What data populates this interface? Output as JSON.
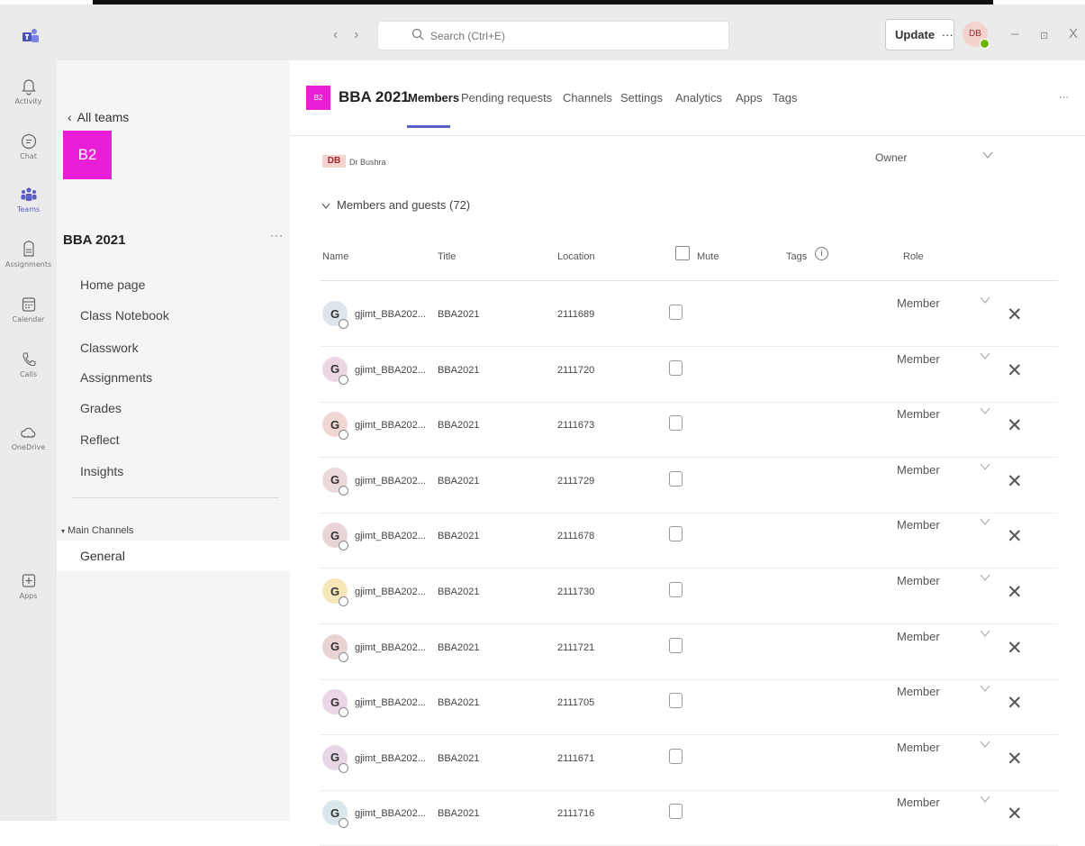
{
  "titlebar": {
    "search_placeholder": "Search (Ctrl+E)",
    "update_label": "Update",
    "update_more": "···",
    "user_initials": "DB",
    "window_controls": [
      "–",
      "⊡",
      "X"
    ]
  },
  "rail": [
    {
      "label": "Activity",
      "icon": "bell-icon"
    },
    {
      "label": "Chat",
      "icon": "chat-icon"
    },
    {
      "label": "Teams",
      "icon": "teams-icon",
      "active": true
    },
    {
      "label": "Assignments",
      "icon": "assignments-icon"
    },
    {
      "label": "Calendar",
      "icon": "calendar-icon"
    },
    {
      "label": "Calls",
      "icon": "phone-icon"
    },
    {
      "label": "OneDrive",
      "icon": "cloud-icon"
    },
    {
      "label": "Apps",
      "icon": "plus-box-icon"
    }
  ],
  "rail_more": "···",
  "sidebar": {
    "back_label": "All teams",
    "team_initials": "B2",
    "team_name": "BBA 2021",
    "team_more": "···",
    "links": [
      "Home page",
      "Class Notebook",
      "Classwork",
      "Assignments",
      "Grades",
      "Reflect",
      "Insights"
    ],
    "channels_heading": "Main Channels",
    "channel": "General"
  },
  "header": {
    "team_initials": "B2",
    "title": "BBA 2021",
    "tabs": [
      "Members",
      "Pending requests",
      "Channels",
      "Settings",
      "Analytics",
      "Apps",
      "Tags"
    ],
    "more": "···"
  },
  "owner": {
    "initials": "DB",
    "name": "Dr Bushra",
    "role": "Owner"
  },
  "members_heading": "Members and guests (72)",
  "columns": {
    "name": "Name",
    "title": "Title",
    "location": "Location",
    "mute": "Mute",
    "tags": "Tags",
    "role": "Role"
  },
  "members": [
    {
      "initial": "G",
      "name": "gjimt_BBA202...",
      "title": "BBA2021",
      "location": "2111689",
      "role": "Member",
      "color": "#dde6ec"
    },
    {
      "initial": "G",
      "name": "gjimt_BBA202...",
      "title": "BBA2021",
      "location": "2111720",
      "role": "Member",
      "color": "#ecd6e3"
    },
    {
      "initial": "G",
      "name": "gjimt_BBA202...",
      "title": "BBA2021",
      "location": "2111673",
      "role": "Member",
      "color": "#f2d6d4"
    },
    {
      "initial": "G",
      "name": "gjimt_BBA202...",
      "title": "BBA2021",
      "location": "2111729",
      "role": "Member",
      "color": "#ecdada"
    },
    {
      "initial": "G",
      "name": "gjimt_BBA202...",
      "title": "BBA2021",
      "location": "2111678",
      "role": "Member",
      "color": "#e9d4d8"
    },
    {
      "initial": "G",
      "name": "gjimt_BBA202...",
      "title": "BBA2021",
      "location": "2111730",
      "role": "Member",
      "color": "#f6e7b9"
    },
    {
      "initial": "G",
      "name": "gjimt_BBA202...",
      "title": "BBA2021",
      "location": "2111721",
      "role": "Member",
      "color": "#ebd3d4"
    },
    {
      "initial": "G",
      "name": "gjimt_BBA202...",
      "title": "BBA2021",
      "location": "2111705",
      "role": "Member",
      "color": "#ead6e6"
    },
    {
      "initial": "G",
      "name": "gjimt_BBA202...",
      "title": "BBA2021",
      "location": "2111671",
      "role": "Member",
      "color": "#e6d6e6"
    },
    {
      "initial": "G",
      "name": "gjimt_BBA202...",
      "title": "BBA2021",
      "location": "2111716",
      "role": "Member",
      "color": "#d9e6ec"
    }
  ],
  "colors": {
    "accent": "#5b5fc7",
    "team_tile": "#e91fd8"
  }
}
